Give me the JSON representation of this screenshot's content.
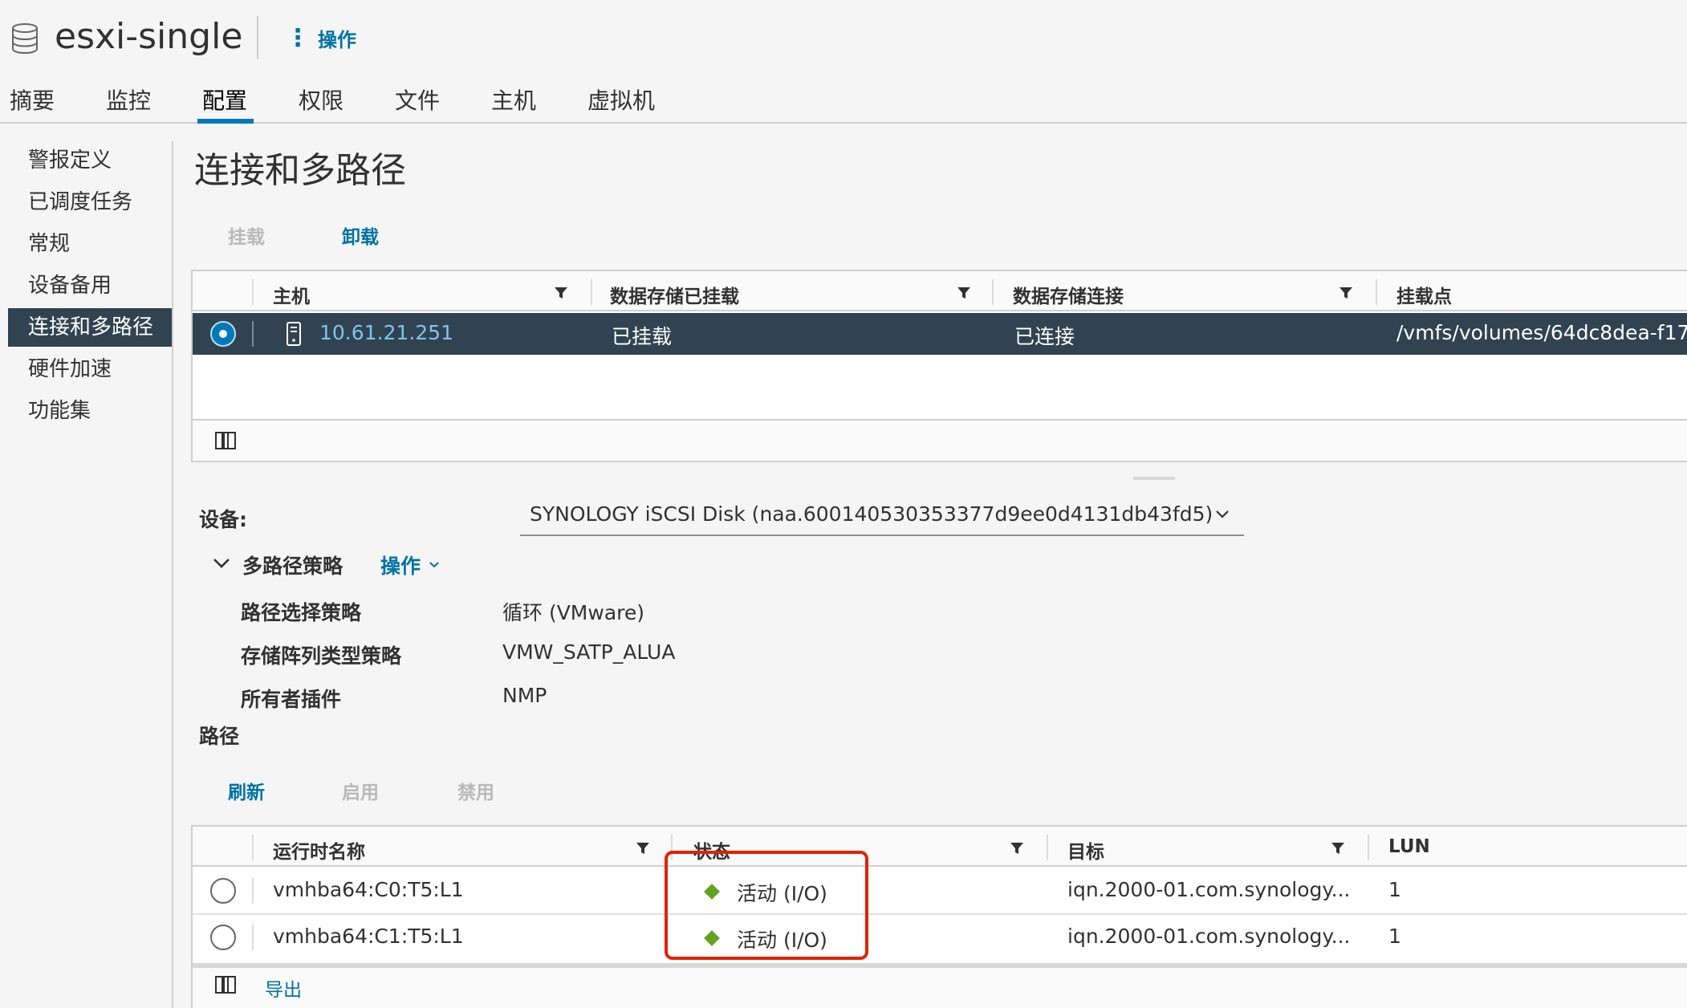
{
  "header": {
    "title": "esxi-single",
    "actions_label": "操作",
    "object_icon": "datastore-icon"
  },
  "tabs": [
    {
      "label": "摘要"
    },
    {
      "label": "监控"
    },
    {
      "label": "配置",
      "active": true
    },
    {
      "label": "权限"
    },
    {
      "label": "文件"
    },
    {
      "label": "主机"
    },
    {
      "label": "虚拟机"
    }
  ],
  "sidebar": {
    "items": [
      {
        "label": "警报定义"
      },
      {
        "label": "已调度任务"
      },
      {
        "label": "常规"
      },
      {
        "label": "设备备用"
      },
      {
        "label": "连接和多路径",
        "selected": true
      },
      {
        "label": "硬件加速"
      },
      {
        "label": "功能集"
      }
    ]
  },
  "main": {
    "title": "连接和多路径",
    "mount_label": "挂载",
    "unmount_label": "卸载"
  },
  "hosts_grid": {
    "columns": [
      "主机",
      "数据存储已挂载",
      "数据存储连接",
      "挂载点"
    ],
    "rows": [
      {
        "host": "10.61.21.251",
        "mounted": "已挂载",
        "connection": "已连接",
        "mount_point": "/vmfs/volumes/64dc8dea-f17"
      }
    ]
  },
  "device": {
    "label": "设备:",
    "value": "SYNOLOGY iSCSI Disk (naa.600140530353377d9ee0d4131db43fd5)"
  },
  "multipath": {
    "section_label": "多路径策略",
    "actions_label": "操作",
    "rows": [
      {
        "label": "路径选择策略",
        "value": "循环 (VMware)"
      },
      {
        "label": "存储阵列类型策略",
        "value": "VMW_SATP_ALUA"
      },
      {
        "label": "所有者插件",
        "value": "NMP"
      }
    ]
  },
  "paths": {
    "section_label": "路径",
    "refresh_label": "刷新",
    "enable_label": "启用",
    "disable_label": "禁用",
    "columns": [
      "运行时名称",
      "状态",
      "目标",
      "LUN"
    ],
    "rows": [
      {
        "runtime_name": "vmhba64:C0:T5:L1",
        "status": "活动 (I/O)",
        "target": "iqn.2000-01.com.synology...",
        "lun": "1"
      },
      {
        "runtime_name": "vmhba64:C1:T5:L1",
        "status": "活动 (I/O)",
        "target": "iqn.2000-01.com.synology...",
        "lun": "1"
      }
    ],
    "export_label": "导出"
  },
  "colors": {
    "accent": "#0072a3",
    "selected_row": "#314351",
    "status_active": "#62a420",
    "highlight": "#e12200"
  }
}
